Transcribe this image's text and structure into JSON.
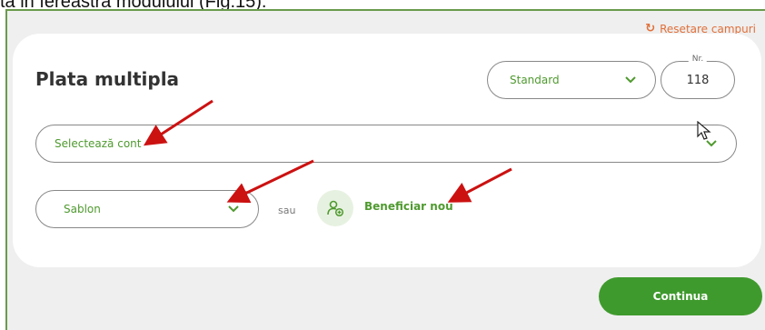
{
  "document": {
    "caption": "ta in fereastra modulului (Fig.15)."
  },
  "header": {
    "reset_label": "Resetare campuri",
    "reset_icon": "reset-icon"
  },
  "form": {
    "title": "Plata multipla",
    "type_select": {
      "value": "Standard"
    },
    "number": {
      "legend": "Nr.",
      "value": "118"
    },
    "account_select": {
      "placeholder": "Selectează cont"
    },
    "template_select": {
      "value": "Sablon"
    },
    "or_label": "sau",
    "new_beneficiary": {
      "label": "Beneficiar nou",
      "icon": "add-user-icon"
    }
  },
  "footer": {
    "continue_label": "Continua"
  },
  "colors": {
    "accent": "#4f9a2f",
    "button": "#3f9a2d",
    "reset": "#e0703a",
    "annotation": "#cc1111"
  }
}
